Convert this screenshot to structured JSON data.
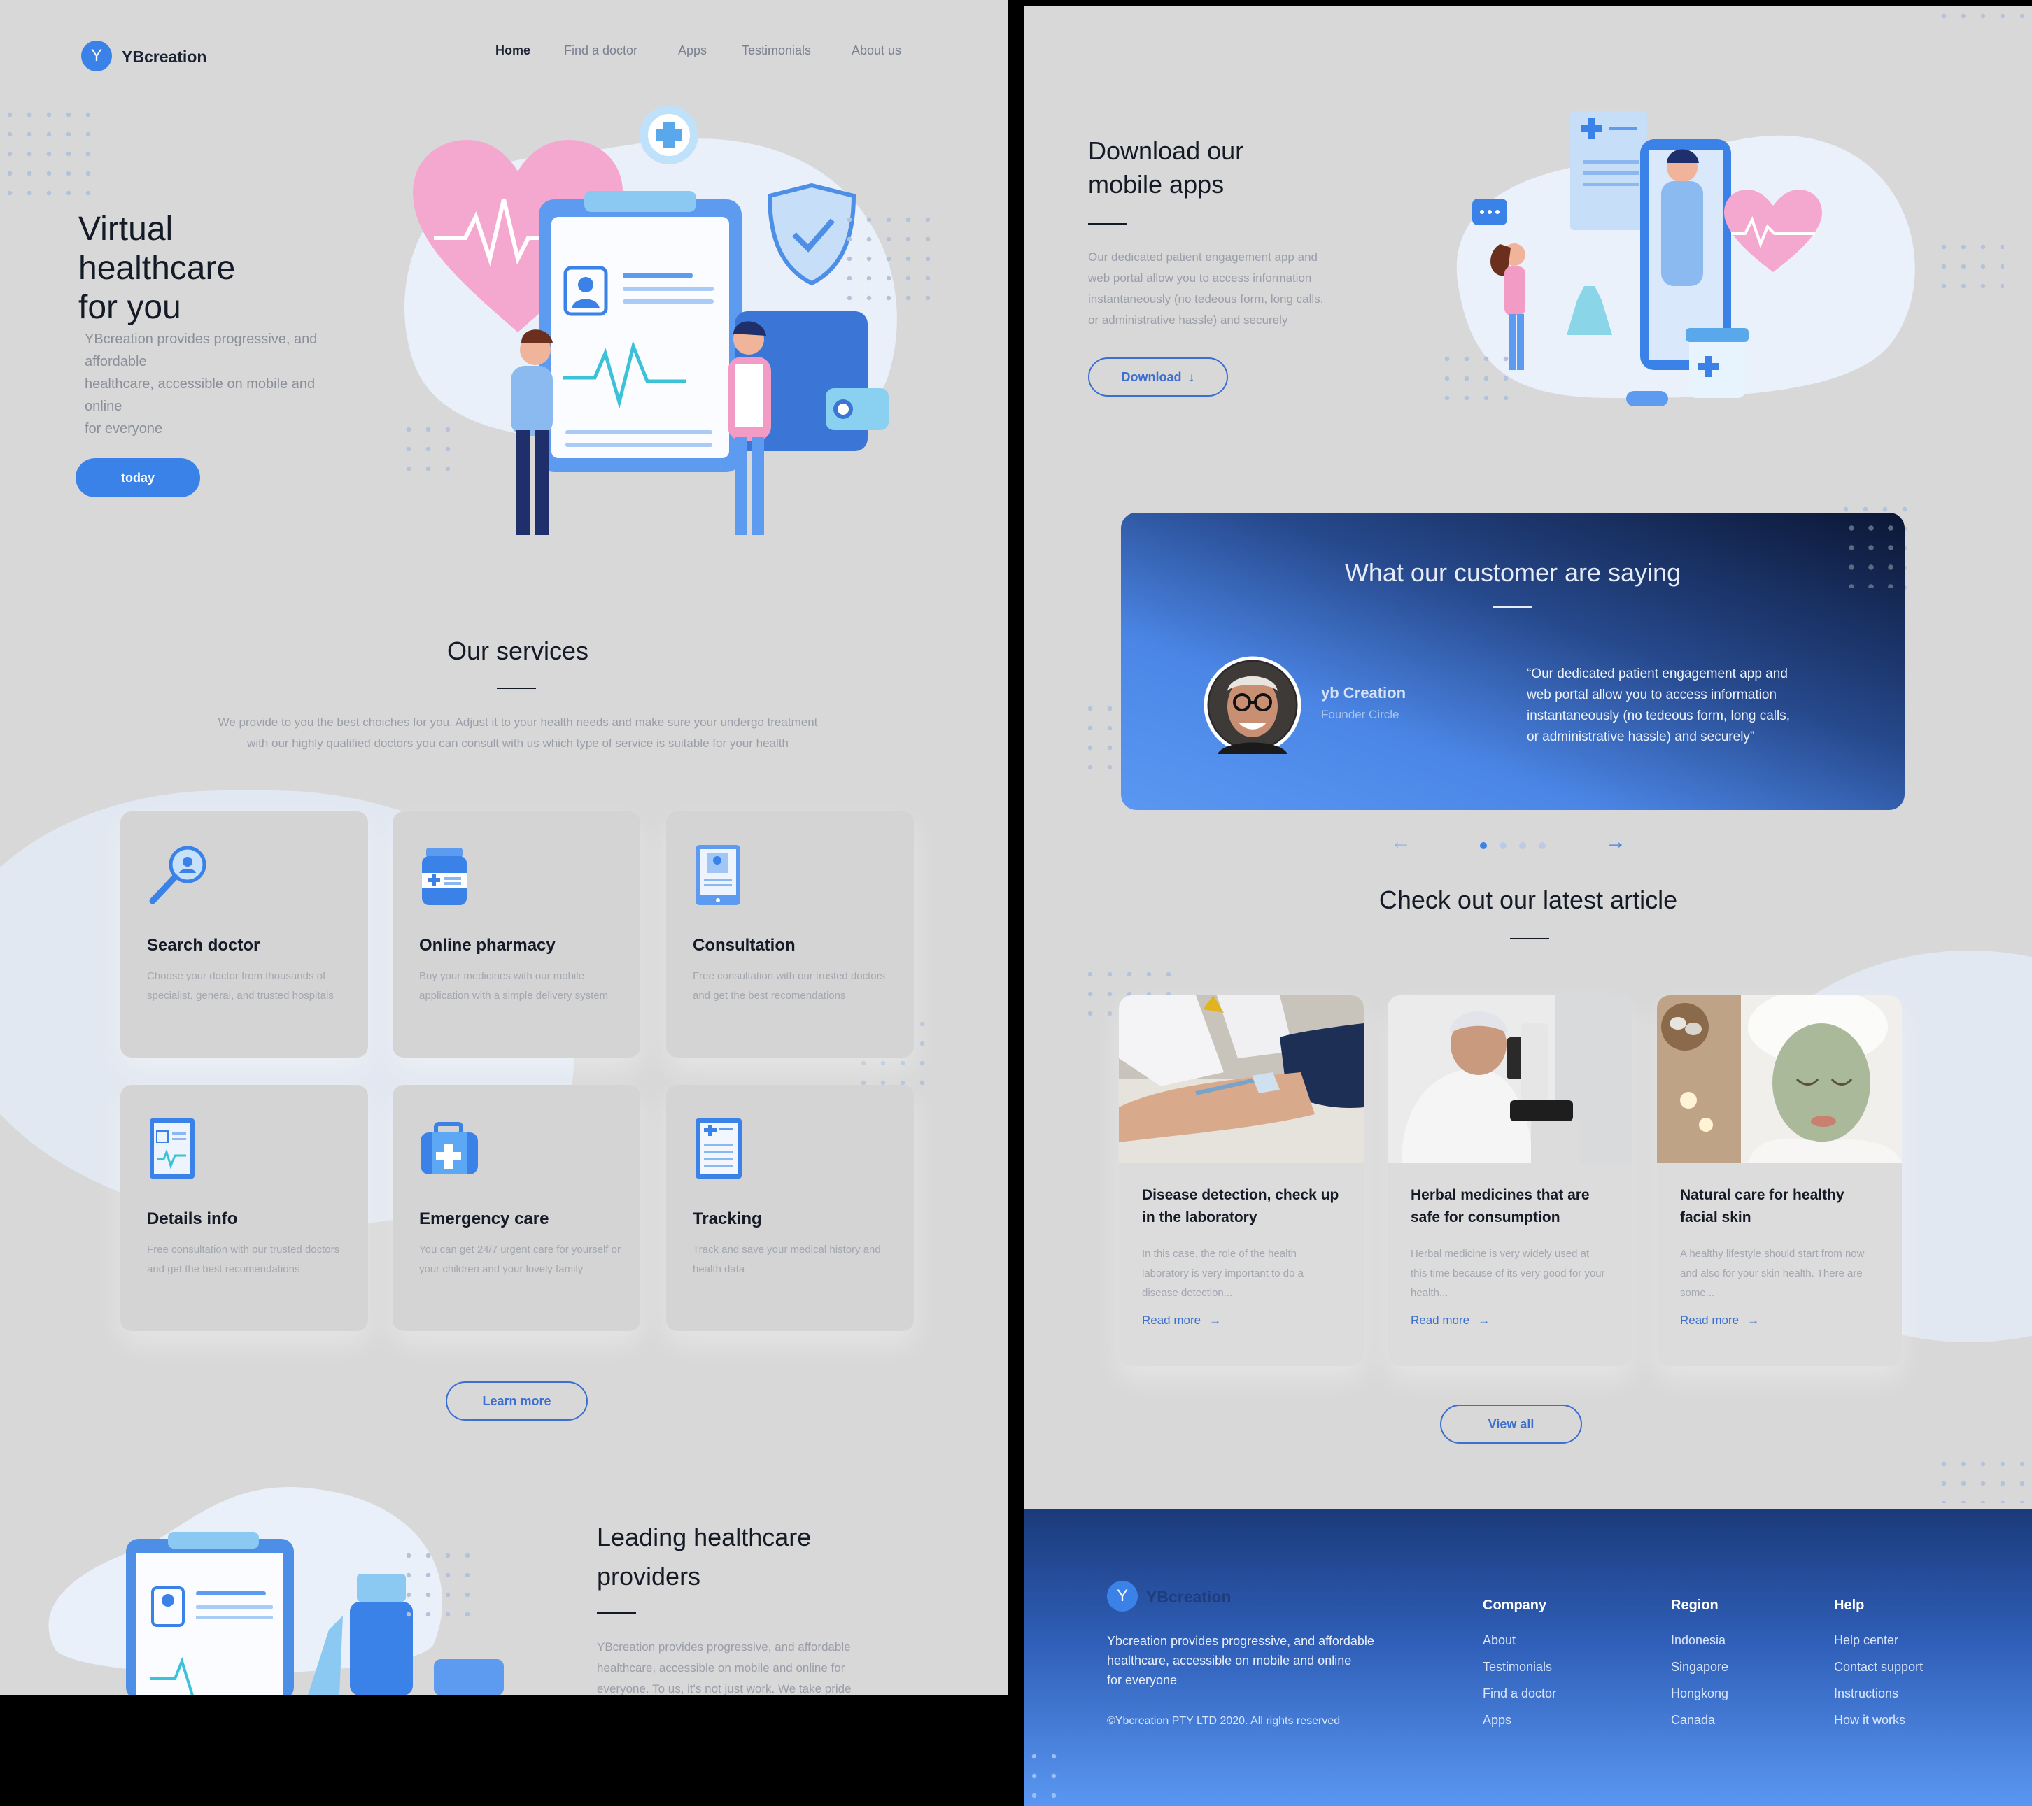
{
  "nav": {
    "brand": "YBcreation",
    "logo_letter": "Y",
    "links": [
      "Home",
      "Find a doctor",
      "Apps",
      "Testimonials",
      "About us"
    ]
  },
  "hero": {
    "title_lines": [
      "Virtual",
      "healthcare",
      "for you"
    ],
    "desc_lines": [
      "YBcreation provides progressive, and",
      "affordable",
      "healthcare, accessible on mobile and",
      "online",
      "for everyone"
    ],
    "button": "today"
  },
  "services": {
    "title": "Our services",
    "desc_lines": [
      "We provide to you the best choiches for you. Adjust it to your health needs and make sure your undergo treatment",
      "with our highly qualified doctors you can consult with us which type of service is suitable for your health"
    ],
    "items": [
      {
        "title": "Search doctor",
        "desc": "Choose your doctor from thousands of specialist, general, and trusted hospitals",
        "icon": "search-icon"
      },
      {
        "title": "Online pharmacy",
        "desc": "Buy  your medicines with our mobile application with a simple delivery system",
        "icon": "pill-bottle-icon"
      },
      {
        "title": "Consultation",
        "desc": "Free consultation with our trusted doctors and get the best recomendations",
        "icon": "tablet-doctor-icon"
      },
      {
        "title": "Details info",
        "desc": "Free consultation with our trusted doctors and get the best recomendations",
        "icon": "medical-record-icon"
      },
      {
        "title": "Emergency care",
        "desc": "You can get 24/7 urgent care for yourself or your children and your lovely family",
        "icon": "first-aid-kit-icon"
      },
      {
        "title": "Tracking",
        "desc": "Track and save your medical history and health data",
        "icon": "document-tracking-icon"
      }
    ],
    "button": "Learn more"
  },
  "leading": {
    "title_lines": [
      "Leading healthcare",
      "providers"
    ],
    "desc_lines": [
      "YBcreation provides progressive, and affordable",
      "healthcare, accessible on mobile and online for",
      "everyone. To us, it's not just work. We take pride"
    ]
  },
  "apps": {
    "title_lines": [
      "Download our",
      "mobile apps"
    ],
    "desc_lines": [
      "Our dedicated patient engagement app and",
      "web portal allow you to access information",
      "instantaneously (no tedeous form, long calls,",
      "or administrative hassle) and securely"
    ],
    "button": "Download"
  },
  "testimonial": {
    "title": "What our customer are saying",
    "name": "yb Creation",
    "role": "Founder Circle",
    "quote_lines": [
      "“Our dedicated patient engagement app and",
      "web portal allow you to access information",
      "instantaneously (no tedeous form, long calls,",
      "or administrative hassle) and securely”"
    ]
  },
  "articles": {
    "title": "Check out our latest article",
    "button": "View all",
    "read_more": "Read more",
    "items": [
      {
        "title": "Disease detection, check up in the laboratory",
        "desc": "In this case, the role of the health laboratory is very important to do a disease detection..."
      },
      {
        "title": "Herbal medicines that are safe for consumption",
        "desc": "Herbal medicine is very widely used at this time because of its very good for your health..."
      },
      {
        "title": "Natural care for healthy facial skin",
        "desc": "A healthy lifestyle should start from now and also for your skin health. There are some..."
      }
    ]
  },
  "footer": {
    "brand": "YBcreation",
    "desc_lines": [
      "Ybcreation provides progressive, and affordable",
      "healthcare, accessible on mobile and online",
      "for everyone"
    ],
    "copyright": "©Ybcreation PTY LTD 2020. All rights reserved",
    "columns": [
      {
        "head": "Company",
        "links": [
          "About",
          "Testimonials",
          "Find a doctor",
          "Apps"
        ]
      },
      {
        "head": "Region",
        "links": [
          "Indonesia",
          "Singapore",
          "Hongkong",
          "Canada"
        ]
      },
      {
        "head": "Help",
        "links": [
          "Help center",
          "Contact support",
          "Instructions",
          "How it works"
        ]
      }
    ]
  },
  "colors": {
    "accent": "#3b82e8",
    "text": "#141a26",
    "muted": "#8a8f9a",
    "bg": "#d8d8d8",
    "dark_navy": "#1b2f5c"
  }
}
